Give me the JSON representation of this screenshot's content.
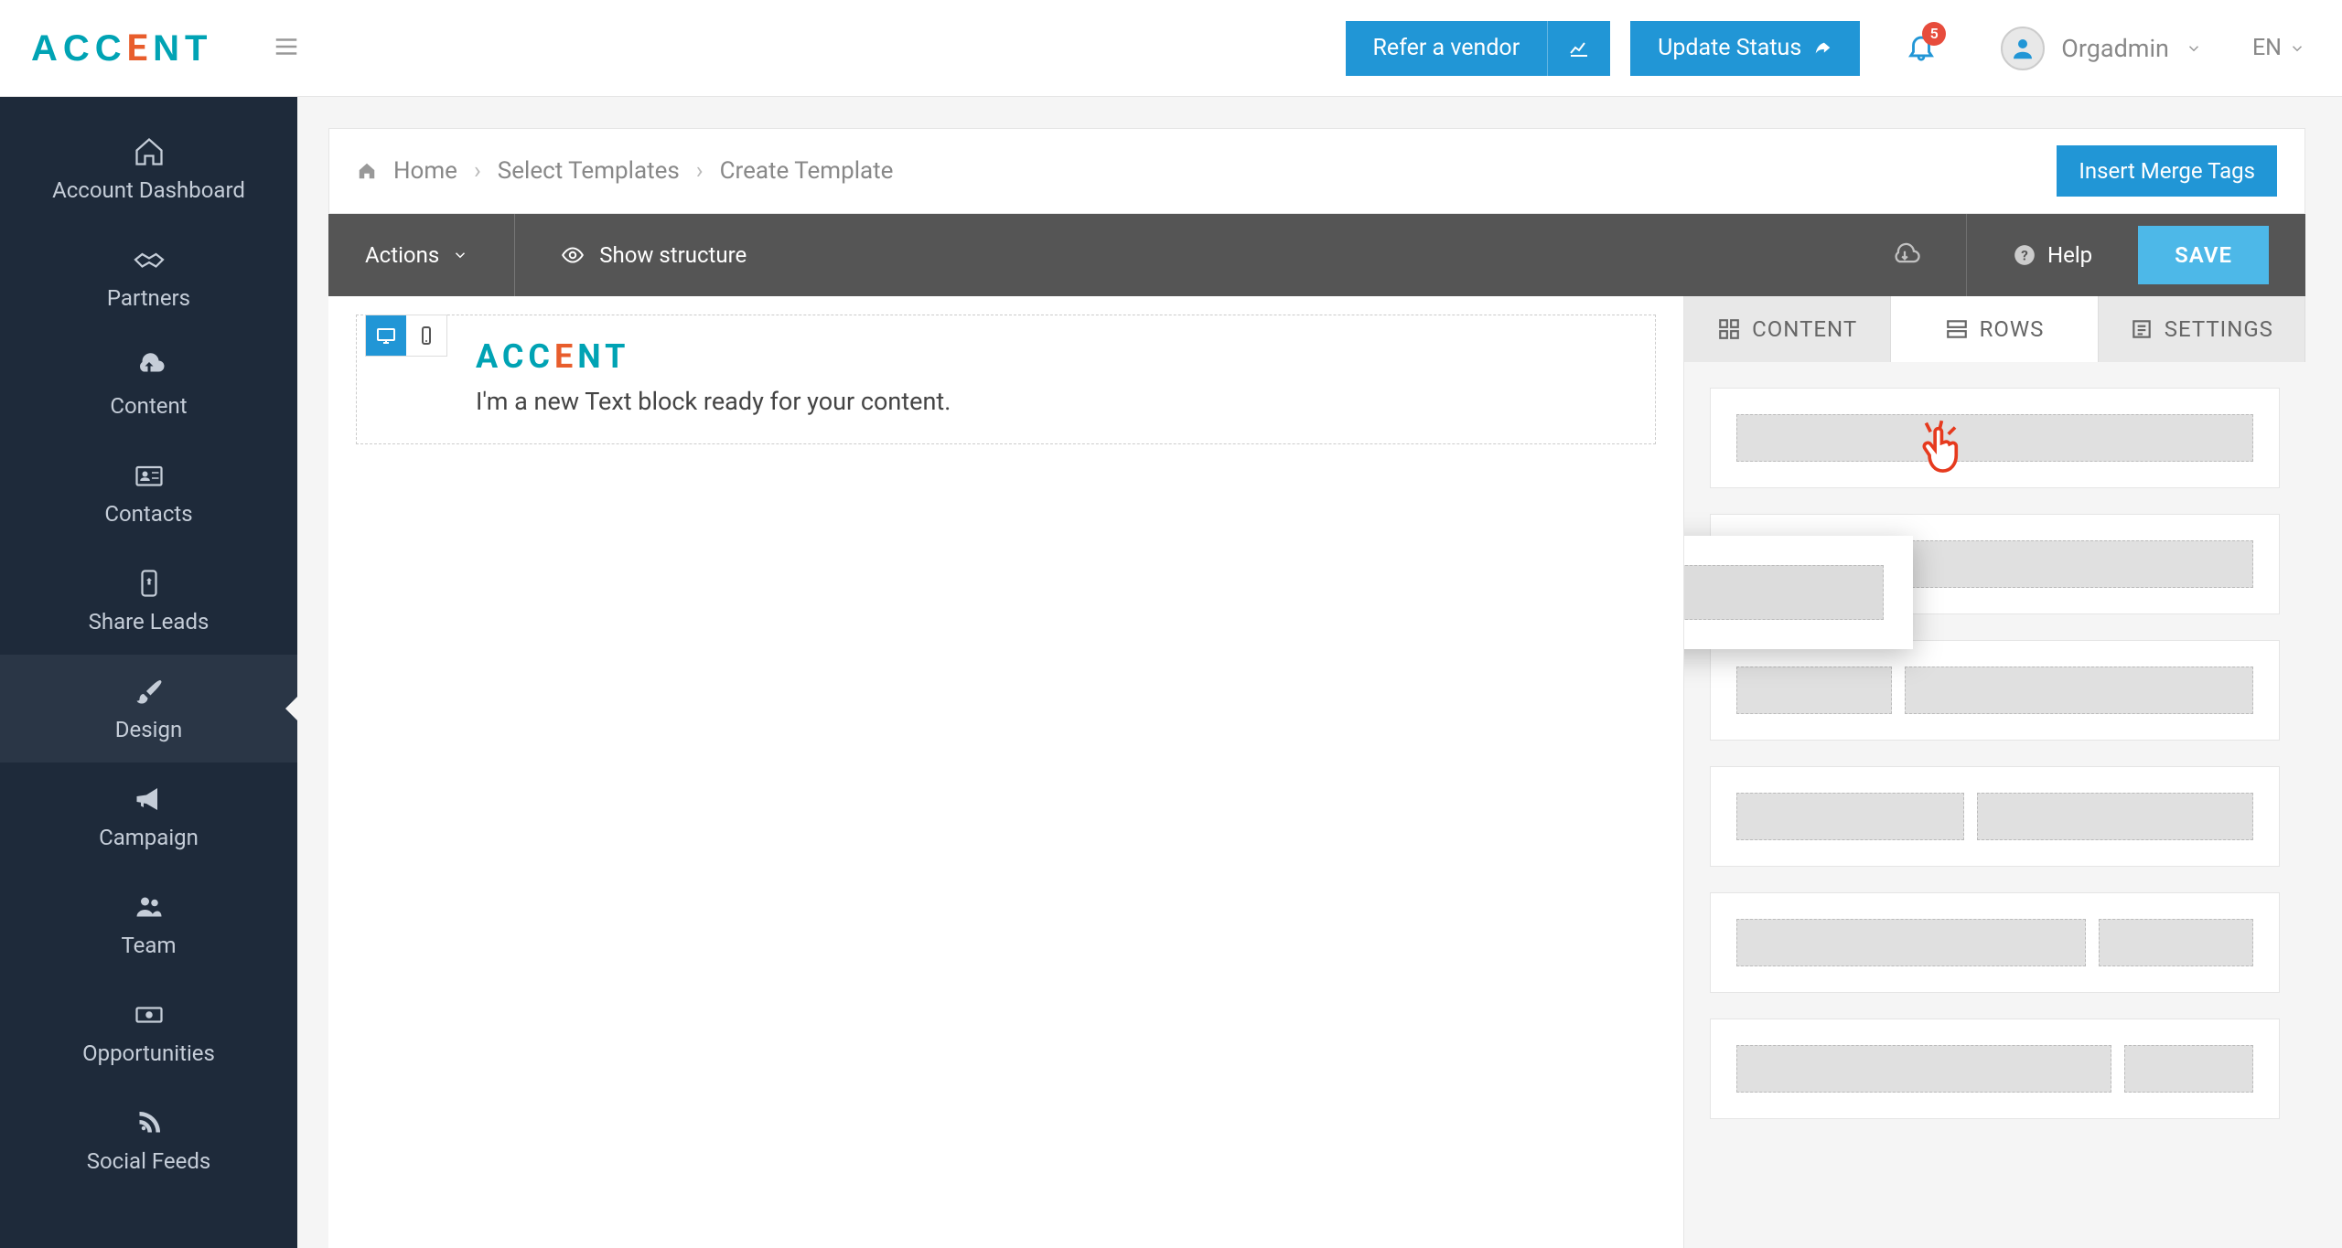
{
  "brand": "ACCENT",
  "topbar": {
    "refer_label": "Refer a vendor",
    "update_label": "Update Status",
    "notification_count": "5",
    "user_name": "Orgadmin",
    "language": "EN"
  },
  "sidebar": {
    "items": [
      {
        "label": "Account Dashboard",
        "icon": "home"
      },
      {
        "label": "Partners",
        "icon": "handshake"
      },
      {
        "label": "Content",
        "icon": "cloud"
      },
      {
        "label": "Contacts",
        "icon": "id-card"
      },
      {
        "label": "Share Leads",
        "icon": "share-phone"
      },
      {
        "label": "Design",
        "icon": "brush",
        "active": true
      },
      {
        "label": "Campaign",
        "icon": "bullhorn"
      },
      {
        "label": "Team",
        "icon": "users"
      },
      {
        "label": "Opportunities",
        "icon": "money"
      },
      {
        "label": "Social Feeds",
        "icon": "rss"
      }
    ]
  },
  "breadcrumbs": {
    "home": "Home",
    "mid": "Select Templates",
    "current": "Create Template"
  },
  "merge_btn": "Insert Merge Tags",
  "editor_toolbar": {
    "actions": "Actions",
    "show_structure": "Show structure",
    "help": "Help",
    "save": "SAVE"
  },
  "canvas": {
    "logo_text": "ACCENT",
    "placeholder": "I'm a new Text block ready for your content."
  },
  "panel": {
    "tabs": {
      "content": "CONTENT",
      "rows": "ROWS",
      "settings": "SETTINGS"
    }
  }
}
